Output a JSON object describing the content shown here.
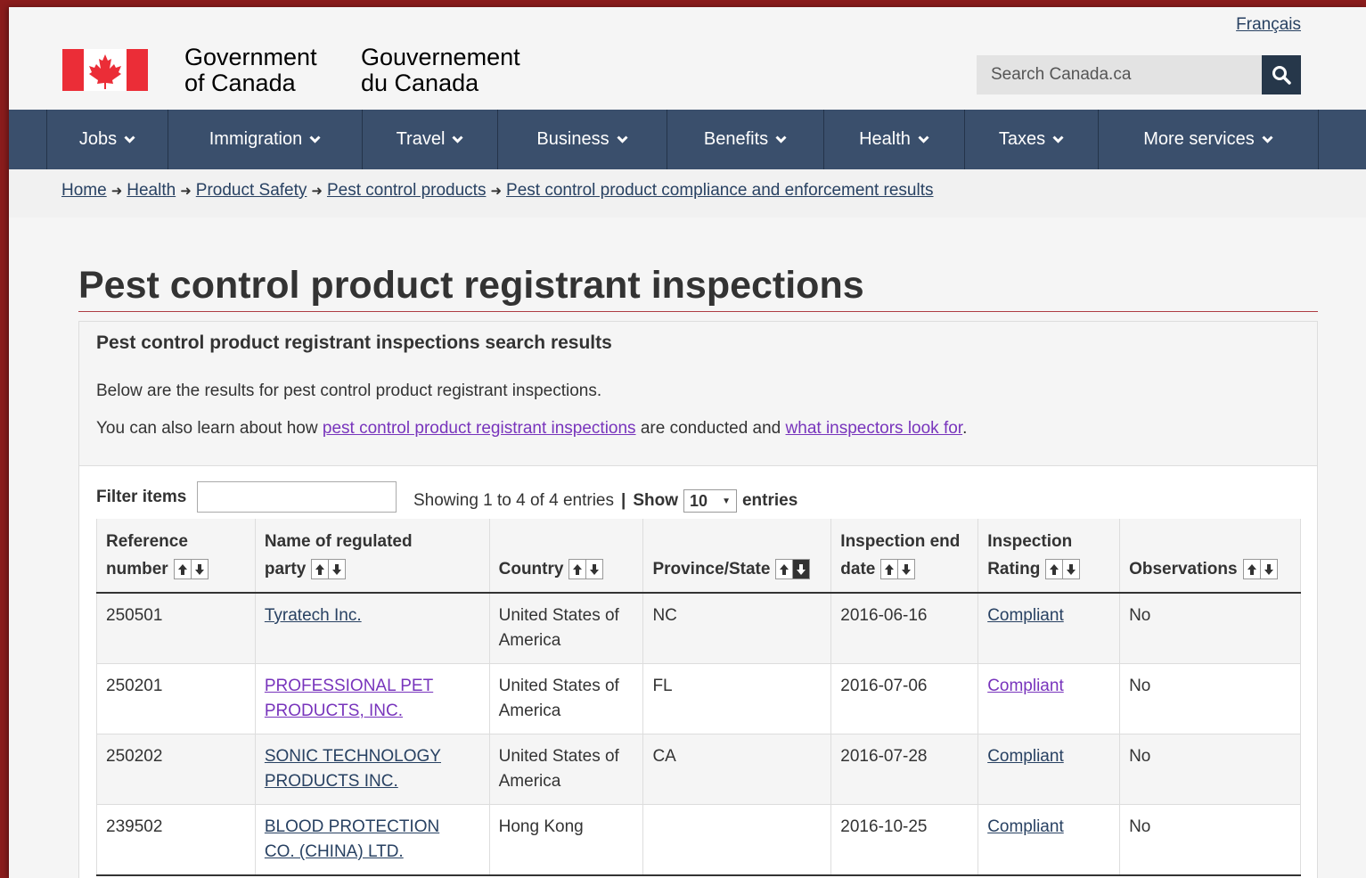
{
  "language_link": "Français",
  "signature": {
    "en_line1": "Government",
    "en_line2": "of Canada",
    "fr_line1": "Gouvernement",
    "fr_line2": "du Canada"
  },
  "search": {
    "placeholder": "Search Canada.ca"
  },
  "menu": [
    {
      "label": "Jobs"
    },
    {
      "label": "Immigration"
    },
    {
      "label": "Travel"
    },
    {
      "label": "Business"
    },
    {
      "label": "Benefits"
    },
    {
      "label": "Health"
    },
    {
      "label": "Taxes"
    },
    {
      "label": "More services"
    }
  ],
  "breadcrumbs": [
    {
      "label": "Home"
    },
    {
      "label": "Health"
    },
    {
      "label": "Product Safety"
    },
    {
      "label": "Pest control products"
    },
    {
      "label": "Pest control product compliance and enforcement results"
    }
  ],
  "page_title": "Pest control product registrant inspections",
  "panel": {
    "title": "Pest control product registrant inspections search results",
    "intro": "Below are the results for pest control product registrant inspections.",
    "learn_prefix": "You can also learn about how ",
    "learn_link1": "pest control product registrant inspections",
    "learn_middle": " are conducted and ",
    "learn_link2": "what inspectors look for",
    "learn_suffix": "."
  },
  "table_controls": {
    "filter_label": "Filter items",
    "filter_value": "",
    "showing": "Showing 1 to 4 of 4 entries",
    "separator": "|",
    "show_label": "Show",
    "page_size": "10",
    "entries_label": "entries"
  },
  "table": {
    "headers": [
      {
        "line1": "Reference",
        "line2": "number"
      },
      {
        "line1": "Name of regulated",
        "line2": "party"
      },
      {
        "line1": "",
        "line2": "Country"
      },
      {
        "line1": "",
        "line2": "Province/State"
      },
      {
        "line1": "Inspection end",
        "line2": "date"
      },
      {
        "line1": "Inspection",
        "line2": "Rating"
      },
      {
        "line1": "",
        "line2": "Observations"
      }
    ],
    "rows": [
      {
        "ref": "250501",
        "name_l1": "Tyratech Inc.",
        "name_l2": "",
        "country_l1": "United States of",
        "country_l2": "America",
        "province": "NC",
        "date": "2016-06-16",
        "rating": "Compliant",
        "observations": "No"
      },
      {
        "ref": "250201",
        "name_l1": "PROFESSIONAL PET",
        "name_l2": "PRODUCTS, INC.",
        "country_l1": "United States of",
        "country_l2": "America",
        "province": "FL",
        "date": "2016-07-06",
        "rating": "Compliant",
        "observations": "No"
      },
      {
        "ref": "250202",
        "name_l1": "SONIC TECHNOLOGY",
        "name_l2": "PRODUCTS INC.",
        "country_l1": "United States of",
        "country_l2": "America",
        "province": "CA",
        "date": "2016-07-28",
        "rating": "Compliant",
        "observations": "No"
      },
      {
        "ref": "239502",
        "name_l1": "BLOOD PROTECTION",
        "name_l2": "CO. (CHINA) LTD.",
        "country_l1": "Hong Kong",
        "country_l2": "",
        "province": "",
        "date": "2016-10-25",
        "rating": "Compliant",
        "observations": "No"
      }
    ]
  },
  "colors": {
    "menu_bg": "#3a4f6c",
    "link": "#284162",
    "visited_link": "#7834bc",
    "title_rule": "#af3c43",
    "flag_red": "#eb2d37"
  },
  "icons": {
    "search": "magnifier-icon",
    "menu_chevron": "chevron-down-icon",
    "sort": "sort-arrows-icon",
    "breadcrumb_separator": "arrow-right-icon"
  }
}
